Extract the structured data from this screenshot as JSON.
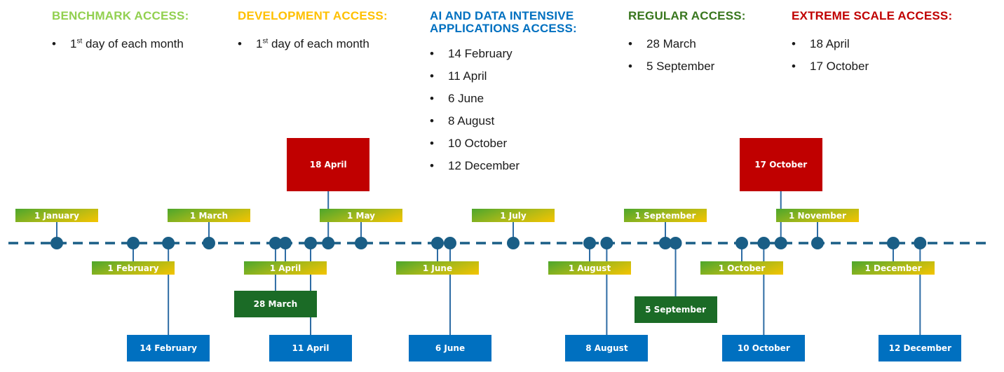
{
  "colors": {
    "benchmark": "#92d050",
    "development": "#ffc000",
    "ai": "#0070c0",
    "regular": "#38761d",
    "extreme": "#c00000",
    "timeline": "#1a5e86"
  },
  "columns": [
    {
      "key": "benchmark",
      "title_lines": [
        "BENCHMARK ACCESS:"
      ],
      "items": [
        {
          "pre": "1",
          "sup": "st",
          "post": " day of each month"
        }
      ]
    },
    {
      "key": "development",
      "title_lines": [
        "DEVELOPMENT ACCESS:"
      ],
      "items": [
        {
          "pre": "1",
          "sup": "st",
          "post": " day of each month"
        }
      ]
    },
    {
      "key": "ai",
      "title_lines": [
        "AI AND DATA INTENSIVE",
        "APPLICATIONS ACCESS:"
      ],
      "items": [
        {
          "pre": "14 February"
        },
        {
          "pre": "11 April"
        },
        {
          "pre": "6 June"
        },
        {
          "pre": "8 August"
        },
        {
          "pre": "10 October"
        },
        {
          "pre": "12 December"
        }
      ]
    },
    {
      "key": "regular",
      "title_lines": [
        "REGULAR ACCESS:"
      ],
      "items": [
        {
          "pre": "28 March"
        },
        {
          "pre": "5 September"
        }
      ]
    },
    {
      "key": "extreme",
      "title_lines": [
        "EXTREME SCALE ACCESS:"
      ],
      "items": [
        {
          "pre": "18 April"
        },
        {
          "pre": "17 October"
        }
      ]
    }
  ],
  "bullet": "•",
  "timeline": {
    "events": [
      {
        "label": "1 January",
        "type": "month",
        "month": 1,
        "day": 1
      },
      {
        "label": "1 February",
        "type": "month",
        "month": 2,
        "day": 1
      },
      {
        "label": "14 February",
        "type": "ai",
        "month": 2,
        "day": 14
      },
      {
        "label": "1 March",
        "type": "month",
        "month": 3,
        "day": 1
      },
      {
        "label": "28 March",
        "type": "regular",
        "month": 3,
        "day": 28
      },
      {
        "label": "1 April",
        "type": "month",
        "month": 4,
        "day": 1
      },
      {
        "label": "11 April",
        "type": "ai",
        "month": 4,
        "day": 11
      },
      {
        "label": "18 April",
        "type": "extreme",
        "month": 4,
        "day": 18
      },
      {
        "label": "1 May",
        "type": "month",
        "month": 5,
        "day": 1
      },
      {
        "label": "1 June",
        "type": "month",
        "month": 6,
        "day": 1
      },
      {
        "label": "6 June",
        "type": "ai",
        "month": 6,
        "day": 6
      },
      {
        "label": "1 July",
        "type": "month",
        "month": 7,
        "day": 1
      },
      {
        "label": "1 August",
        "type": "month",
        "month": 8,
        "day": 1
      },
      {
        "label": "8 August",
        "type": "ai",
        "month": 8,
        "day": 8
      },
      {
        "label": "1 September",
        "type": "month",
        "month": 9,
        "day": 1
      },
      {
        "label": "5 September",
        "type": "regular",
        "month": 9,
        "day": 5
      },
      {
        "label": "1 October",
        "type": "month",
        "month": 10,
        "day": 1
      },
      {
        "label": "10 October",
        "type": "ai",
        "month": 10,
        "day": 10
      },
      {
        "label": "17 October",
        "type": "extreme",
        "month": 10,
        "day": 17
      },
      {
        "label": "1 November",
        "type": "month",
        "month": 11,
        "day": 1
      },
      {
        "label": "1 December",
        "type": "month",
        "month": 12,
        "day": 1
      },
      {
        "label": "12 December",
        "type": "ai",
        "month": 12,
        "day": 12
      }
    ]
  }
}
